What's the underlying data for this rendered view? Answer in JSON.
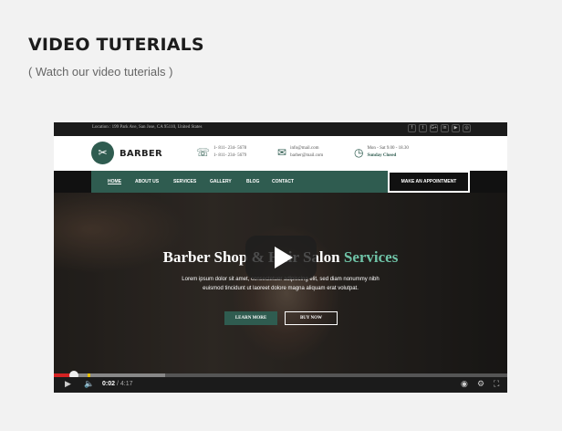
{
  "section": {
    "title": "VIDEO TUTERIALS",
    "subtitle": "( Watch our video tuterials )"
  },
  "site": {
    "location": "Location : 199 Park Ave, San Jose, CA 95110, United States",
    "social": [
      "f",
      "t",
      "G+",
      "in",
      "▶",
      "◎"
    ],
    "brand": "BARBER",
    "phone": [
      "1- 811- 234- 5678",
      "1- 811- 234- 5679"
    ],
    "email": [
      "info@mail.com",
      "barber@mail.com"
    ],
    "hours": [
      "Mon - Sat 9.00 - 18.30",
      "Sunday Closed"
    ],
    "nav": [
      "HOME",
      "ABOUT US",
      "SERVICES",
      "GALLERY",
      "BLOG",
      "CONTACT"
    ],
    "appointment": "MAKE AN APPOINTMENT",
    "hero_title_a": "Barber Shop & Hair Salon ",
    "hero_title_b": "Services",
    "hero_desc": "Lorem ipsum dolor sit amet, consectetuer adipiscing elit, sed diam nonummy nibh euismod tincidunt ut laoreet dolore magna aliquam erat volutpat.",
    "btn_more": "LEARN MORE",
    "btn_buy": "BUY NOW"
  },
  "player": {
    "current_time": "0:02",
    "separator": " / ",
    "duration": "4:17",
    "played_fraction": 0.004,
    "accent": "#d32222"
  },
  "colors": {
    "brand_green": "#2f5c50",
    "accent_green": "#6fc3a7"
  }
}
